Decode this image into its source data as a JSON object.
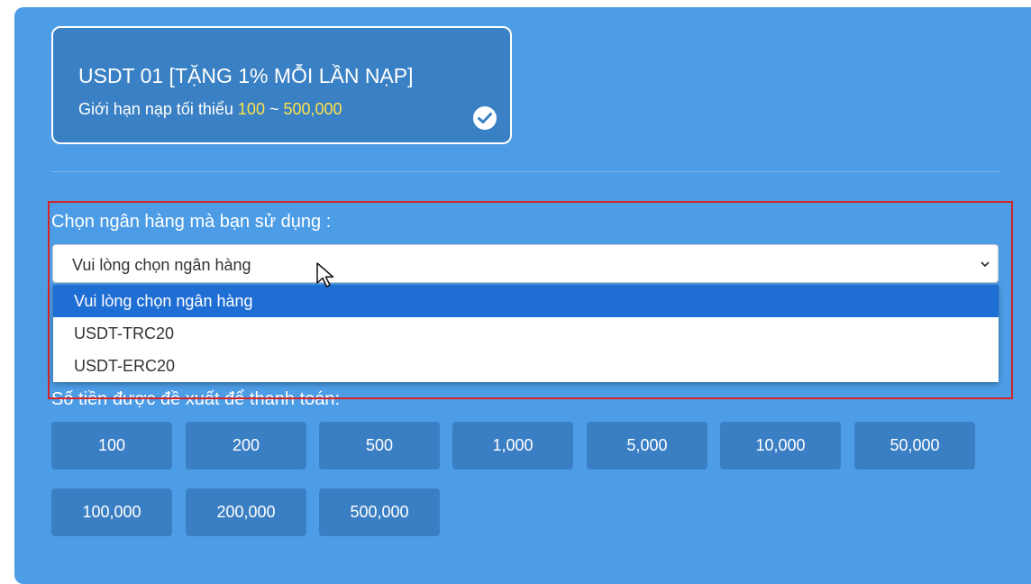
{
  "card": {
    "title": "USDT 01 [TẶNG 1% MỖI LẦN NẠP]",
    "limit_prefix": "Giới hạn nạp tối thiểu ",
    "min": "100",
    "separator": " ~ ",
    "max": "500,000"
  },
  "bank": {
    "label": "Chọn ngân hàng mà bạn sử dụng :",
    "selected": "Vui lòng chọn ngân hàng",
    "options": [
      {
        "label": "Vui lòng chọn ngân hàng"
      },
      {
        "label": "USDT-TRC20"
      },
      {
        "label": "USDT-ERC20"
      }
    ]
  },
  "amount": {
    "label": "Số tiền được đề xuất để thanh toán:",
    "buttons": [
      "100",
      "200",
      "500",
      "1,000",
      "5,000",
      "10,000",
      "50,000",
      "100,000",
      "200,000",
      "500,000"
    ]
  },
  "colors": {
    "background": "#4d9de6",
    "card": "#3a80c4",
    "highlight_text": "#ffe24a",
    "selected_option": "#1f6ed4",
    "annotation_box": "#d42426"
  },
  "icons": [
    "check-icon",
    "chevron-down-icon",
    "mouse-cursor-icon"
  ]
}
